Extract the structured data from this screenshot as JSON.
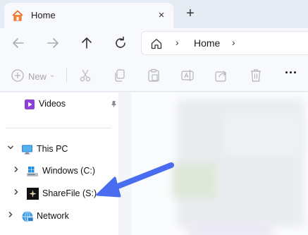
{
  "tab": {
    "title": "Home",
    "close_icon": "×",
    "new_tab_icon": "+"
  },
  "navigation": {
    "address_segments": [
      "Home"
    ],
    "separator": "›"
  },
  "toolbar": {
    "new_label": "New",
    "new_caret": "⌄",
    "more_label": "···"
  },
  "sidebar": {
    "pinned": [
      {
        "label": "Videos",
        "icon": "videos-icon",
        "pinned": true
      }
    ],
    "this_pc": {
      "label": "This PC",
      "expanded": true,
      "children": [
        {
          "label": "Windows (C:)",
          "icon": "drive-icon"
        },
        {
          "label": "ShareFile (S:)",
          "icon": "sharefile-icon"
        }
      ]
    },
    "network": {
      "label": "Network",
      "icon": "network-icon"
    }
  },
  "colors": {
    "annotation_arrow": "#4a6cf0",
    "accent": "#1a73e8"
  }
}
